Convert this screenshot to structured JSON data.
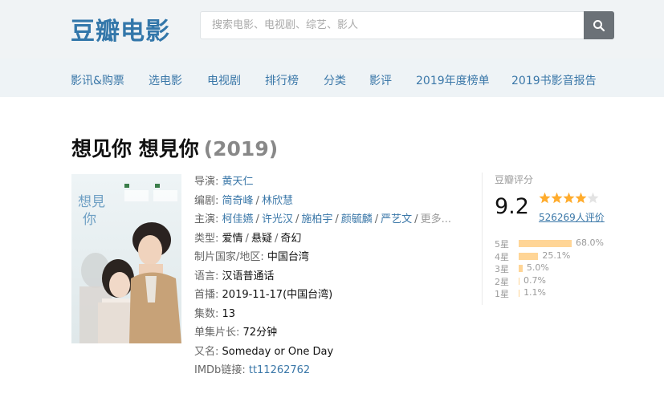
{
  "header": {
    "logo": "豆瓣电影",
    "search_placeholder": "搜索电影、电视剧、综艺、影人"
  },
  "nav": [
    {
      "label": "影讯&购票"
    },
    {
      "label": "选电影"
    },
    {
      "label": "电视剧"
    },
    {
      "label": "排行榜"
    },
    {
      "label": "分类"
    },
    {
      "label": "影评"
    },
    {
      "label": "2019年度榜单"
    },
    {
      "label": "2019书影音报告"
    }
  ],
  "title": {
    "name": "想见你 想見你",
    "year": "(2019)"
  },
  "poster": {
    "text_top": "想見",
    "text_bottom": "你"
  },
  "info": {
    "director_label": "导演:",
    "director": "黄天仁",
    "writer_label": "编剧:",
    "writers": [
      "简奇峰",
      "林欣慧"
    ],
    "cast_label": "主演:",
    "cast": [
      "柯佳嬿",
      "许光汉",
      "施柏宇",
      "颜毓麟",
      "严艺文"
    ],
    "cast_more": "更多...",
    "genre_label": "类型:",
    "genres": [
      "爱情",
      "悬疑",
      "奇幻"
    ],
    "country_label": "制片国家/地区:",
    "country": "中国台湾",
    "language_label": "语言:",
    "language": "汉语普通话",
    "premiere_label": "首播:",
    "premiere": "2019-11-17(中国台湾)",
    "episodes_label": "集数:",
    "episodes": "13",
    "runtime_label": "单集片长:",
    "runtime": "72分钟",
    "aka_label": "又名:",
    "aka": "Someday or One Day",
    "imdb_label": "IMDb链接:",
    "imdb": "tt11262762"
  },
  "rating": {
    "label": "豆瓣评分",
    "score": "9.2",
    "stars_value": 4.5,
    "count": "526269人评价",
    "distribution": [
      {
        "star": "5星",
        "percent": "68.0%",
        "value": 68.0
      },
      {
        "star": "4星",
        "percent": "25.1%",
        "value": 25.1
      },
      {
        "star": "3星",
        "percent": "5.0%",
        "value": 5.0
      },
      {
        "star": "2星",
        "percent": "0.7%",
        "value": 0.7
      },
      {
        "star": "1星",
        "percent": "1.1%",
        "value": 1.1
      }
    ]
  },
  "colors": {
    "link": "#3a77a8",
    "star": "#ffac2d",
    "bar": "#ffd596"
  }
}
